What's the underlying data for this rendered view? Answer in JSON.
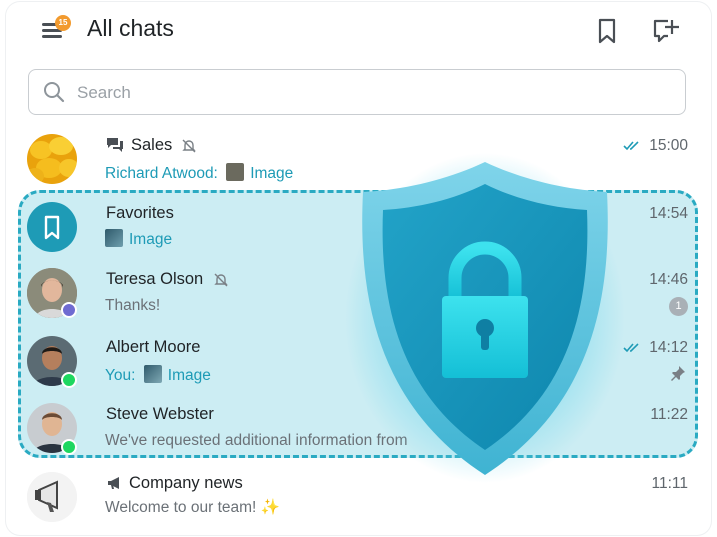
{
  "header": {
    "title": "All chats",
    "menu_badge": "15",
    "bookmark_icon": "bookmark-icon",
    "new_chat_icon": "new-chat-icon"
  },
  "search": {
    "placeholder": "Search"
  },
  "colors": {
    "accent": "#1e9bb6",
    "highlight": "#ccedf3",
    "online": "#1ed760",
    "badge": "#f29a2e"
  },
  "chats": [
    {
      "name": "Sales",
      "sender": "Richard Atwood:",
      "preview": "Image",
      "time": "15:00",
      "icons": [
        "chat-bubbles-icon",
        "muted-bell-icon",
        "double-check-icon"
      ]
    },
    {
      "name": "Favorites",
      "preview": "Image",
      "time": "14:54",
      "icons": [
        "bookmark-icon"
      ]
    },
    {
      "name": "Teresa Olson",
      "preview": "Thanks!",
      "time": "14:46",
      "unread": "1",
      "icons": [
        "muted-bell-icon",
        "clock-icon"
      ]
    },
    {
      "name": "Albert Moore",
      "sender": "You:",
      "preview": "Image",
      "time": "14:12",
      "icons": [
        "double-check-icon",
        "pin-icon"
      ]
    },
    {
      "name": "Steve Webster",
      "preview": "We've requested additional information from",
      "time": "11:22",
      "icons": []
    },
    {
      "name": "Company news",
      "preview": "Welcome to our team! ✨",
      "time": "11:11",
      "icons": [
        "megaphone-icon"
      ]
    }
  ]
}
